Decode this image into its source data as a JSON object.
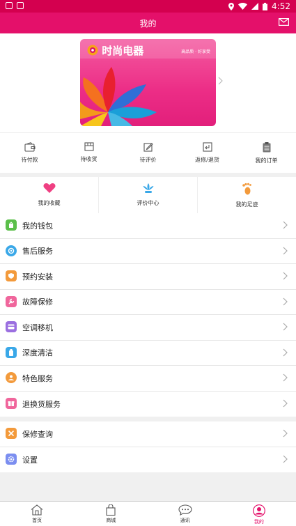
{
  "status_bar": {
    "time": "4:52"
  },
  "header": {
    "title": "我的"
  },
  "banner": {
    "brand": "时尚电器",
    "slogan": "高品质 · 好享受"
  },
  "orders": [
    {
      "label": "待付款",
      "icon": "wallet-icon"
    },
    {
      "label": "待收货",
      "icon": "box-icon"
    },
    {
      "label": "待评价",
      "icon": "edit-icon"
    },
    {
      "label": "返修/退货",
      "icon": "return-icon"
    },
    {
      "label": "我的订单",
      "icon": "clipboard-icon"
    }
  ],
  "shortcuts": [
    {
      "label": "我的收藏",
      "icon": "heart-icon"
    },
    {
      "label": "评价中心",
      "icon": "lotus-icon"
    },
    {
      "label": "我的足迹",
      "icon": "footprint-icon"
    }
  ],
  "menu": [
    {
      "label": "我的钱包",
      "icon": "wallet-icon",
      "color": "#5bbf4a"
    },
    {
      "label": "售后服务",
      "icon": "gear-icon",
      "color": "#3aa8e8"
    },
    {
      "label": "预约安装",
      "icon": "shield-icon",
      "color": "#f39a3b"
    },
    {
      "label": "故障保修",
      "icon": "wrench-icon",
      "color": "#f0669c"
    },
    {
      "label": "空调移机",
      "icon": "card-icon",
      "color": "#9b6fe0"
    },
    {
      "label": "深度清洁",
      "icon": "bottle-icon",
      "color": "#3aa8e8"
    },
    {
      "label": "特色服务",
      "icon": "hand-icon",
      "color": "#f39a3b"
    },
    {
      "label": "退换货服务",
      "icon": "gift-icon",
      "color": "#f0669c"
    }
  ],
  "menu2": [
    {
      "label": "保修查询",
      "icon": "tools-icon",
      "color": "#f39a3b"
    },
    {
      "label": "设置",
      "icon": "settings-icon",
      "color": "#7b8ef0"
    }
  ],
  "tabs": [
    {
      "label": "首页",
      "icon": "home-icon"
    },
    {
      "label": "商城",
      "icon": "bag-icon"
    },
    {
      "label": "通讯",
      "icon": "chat-icon"
    },
    {
      "label": "我的",
      "icon": "user-icon",
      "active": true
    }
  ],
  "colors": {
    "accent": "#e4106a",
    "status_bar": "#d4004f"
  }
}
